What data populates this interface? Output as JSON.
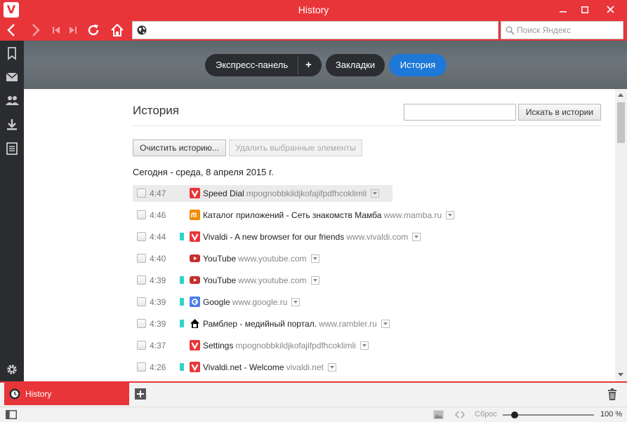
{
  "window": {
    "title": "History"
  },
  "toolbar": {
    "address_value": "",
    "search_placeholder": "Поиск Яндекс"
  },
  "header": {
    "speed_dial": "Экспресс-панель",
    "add": "+",
    "bookmarks": "Закладки",
    "history": "История"
  },
  "page": {
    "title": "История",
    "search_value": "",
    "search_button": "Искать в истории",
    "clear_button": "Очистить историю...",
    "delete_button": "Удалить выбранные элементы",
    "day_heading": "Сегодня - среда, 8 апреля 2015 г."
  },
  "history": [
    {
      "time": "4:47",
      "bookmarked": false,
      "icon": "vivaldi-icon",
      "title": "Speed Dial",
      "url": "mpognobbkildjkofajifpdfhcoklimli",
      "selected": true
    },
    {
      "time": "4:46",
      "bookmarked": false,
      "icon": "mamba-icon",
      "title": "Каталог приложений - Сеть знакомств Мамба",
      "url": "www.mamba.ru",
      "selected": false
    },
    {
      "time": "4:44",
      "bookmarked": true,
      "icon": "vivaldi-icon",
      "title": "Vivaldi - A new browser for our friends",
      "url": "www.vivaldi.com",
      "selected": false
    },
    {
      "time": "4:40",
      "bookmarked": false,
      "icon": "youtube-icon",
      "title": "YouTube",
      "url": "www.youtube.com",
      "selected": false
    },
    {
      "time": "4:39",
      "bookmarked": true,
      "icon": "youtube-icon",
      "title": "YouTube",
      "url": "www.youtube.com",
      "selected": false
    },
    {
      "time": "4:39",
      "bookmarked": true,
      "icon": "google-icon",
      "title": "Google",
      "url": "www.google.ru",
      "selected": false
    },
    {
      "time": "4:39",
      "bookmarked": true,
      "icon": "rambler-icon",
      "title": "Рамблер - медийный портал.",
      "url": "www.rambler.ru",
      "selected": false
    },
    {
      "time": "4:37",
      "bookmarked": false,
      "icon": "vivaldi-icon",
      "title": "Settings",
      "url": "mpognobbkildjkofajifpdfhcoklimli",
      "selected": false
    },
    {
      "time": "4:26",
      "bookmarked": true,
      "icon": "vivaldi-icon",
      "title": "Vivaldi.net - Welcome",
      "url": "vivaldi.net",
      "selected": false
    }
  ],
  "tabs": [
    {
      "label": "History"
    }
  ],
  "status": {
    "reset": "Сброс",
    "zoom": "100 %",
    "zoom_level": 0.13
  },
  "colors": {
    "accent": "#e8353a",
    "active_pill": "#1e78d8",
    "bookmark_marker": "#30d5c8",
    "panel_dark": "#2a2c30"
  }
}
